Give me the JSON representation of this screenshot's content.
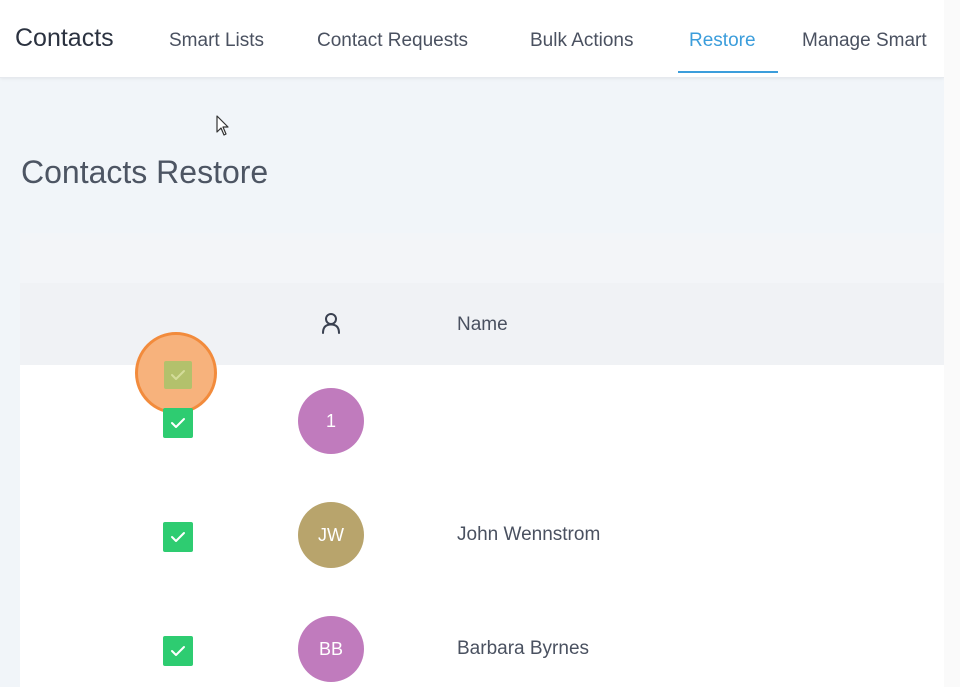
{
  "header": {
    "title": "Contacts",
    "tabs": [
      {
        "label": "Smart Lists"
      },
      {
        "label": "Contact Requests"
      },
      {
        "label": "Bulk Actions"
      },
      {
        "label": "Restore"
      },
      {
        "label": "Manage Smart"
      }
    ],
    "active_tab": "Restore"
  },
  "page": {
    "title": "Contacts Restore"
  },
  "table": {
    "columns": {
      "contact_icon": "person-icon",
      "name": "Name"
    },
    "select_all_checked": true,
    "rows": [
      {
        "initials": "1",
        "name": "",
        "checked": true,
        "avatar_color": "#c07bbd"
      },
      {
        "initials": "JW",
        "name": "John Wennstrom",
        "checked": true,
        "avatar_color": "#b8a46c"
      },
      {
        "initials": "BB",
        "name": "Barbara Byrnes",
        "checked": true,
        "avatar_color": "#c07bbd"
      }
    ]
  },
  "colors": {
    "accent": "#3b9ddb",
    "checkbox_checked": "#2ecc71",
    "highlight": "#f28b3c"
  }
}
